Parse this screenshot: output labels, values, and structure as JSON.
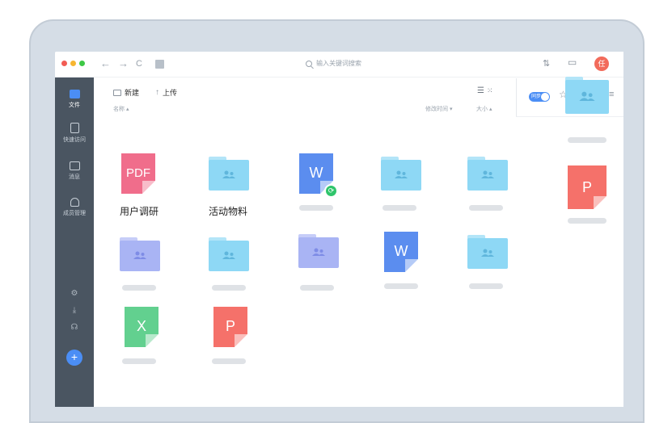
{
  "window": {
    "search_placeholder": "输入关键词搜索",
    "avatar_initial": "任",
    "back_glyph": "←",
    "forward_glyph": "→",
    "refresh_glyph": "C",
    "transfer_glyph": "⇅",
    "screen_glyph": "▭"
  },
  "sidebar": {
    "items": [
      {
        "label": "文件",
        "icon": "file-icon",
        "active": true
      },
      {
        "label": "快速访问",
        "icon": "quick-access-icon",
        "active": false
      },
      {
        "label": "消息",
        "icon": "message-icon",
        "active": false
      },
      {
        "label": "成员管理",
        "icon": "members-icon",
        "active": false
      }
    ],
    "bottom_icons": [
      "settings-icon",
      "download-icon",
      "support-icon"
    ],
    "fab_label": "+"
  },
  "toolbar": {
    "new_label": "新建",
    "upload_label": "上传",
    "sort_name": "名称 ▴",
    "sort_modified": "修改时间 ▾",
    "sort_size": "大小 ▴",
    "list_view_glyph": "☰",
    "grid_view_glyph": "⁙"
  },
  "panel": {
    "sync_label": "同步",
    "star_glyph": "☆",
    "menu_glyph": "≡",
    "doc_letter": "P"
  },
  "files": {
    "pdf_text": "PDF",
    "pdf_name": "用户调研",
    "folder_name": "活动物料",
    "word_letter": "W",
    "excel_letter": "X",
    "ppt_letter": "P"
  },
  "colors": {
    "accent": "#4b8ef5",
    "sidebar": "#4a5561",
    "pdf": "#f06d8b",
    "word": "#5b8def",
    "excel": "#62d08f",
    "ppt": "#f5716a",
    "folder_blue": "#8ed8f5",
    "folder_purple": "#a9b4f4"
  }
}
